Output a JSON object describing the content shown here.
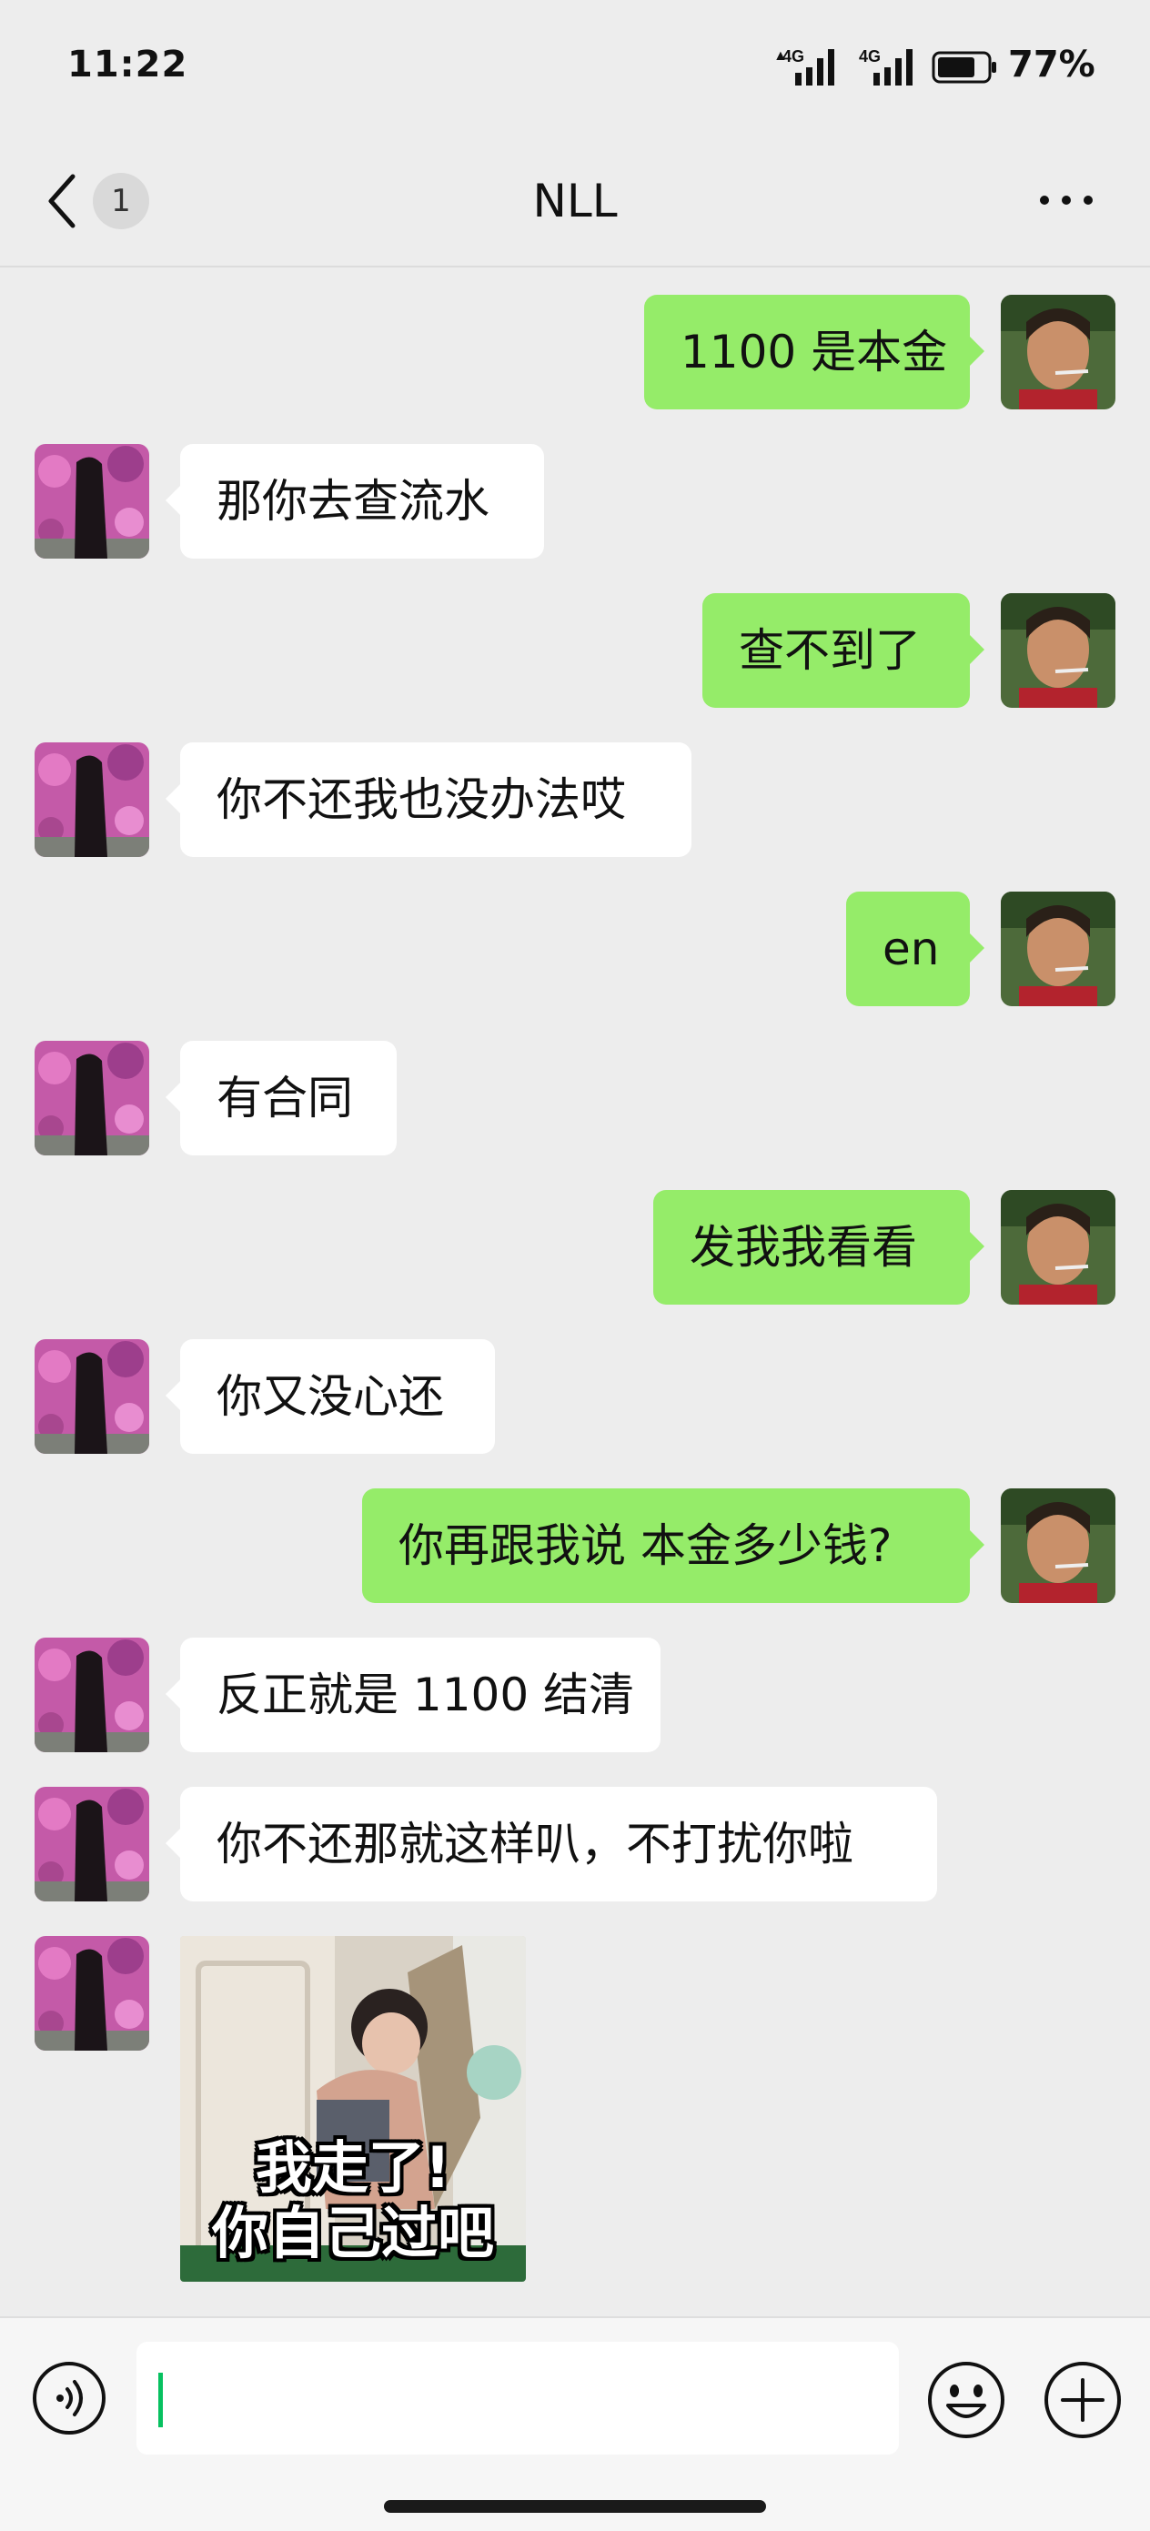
{
  "status_bar": {
    "time": "11:22",
    "network1": "4G",
    "network2": "4G",
    "battery": "77%"
  },
  "header": {
    "unread_count": "1",
    "title": "NLL"
  },
  "messages": [
    {
      "from": "me",
      "text": "1100 是本金"
    },
    {
      "from": "them",
      "text": "那你去查流水"
    },
    {
      "from": "me",
      "text": "查不到了"
    },
    {
      "from": "them",
      "text": "你不还我也没办法哎"
    },
    {
      "from": "me",
      "text": "en"
    },
    {
      "from": "them",
      "text": "有合同"
    },
    {
      "from": "me",
      "text": "发我我看看"
    },
    {
      "from": "them",
      "text": "你又没心还"
    },
    {
      "from": "me",
      "text": "你再跟我说  本金多少钱?"
    },
    {
      "from": "them",
      "text": "反正就是 1100 结清"
    },
    {
      "from": "them",
      "text": "你不还那就这样叭，不打扰你啦"
    }
  ],
  "sticker": {
    "line1": "我走了!",
    "line2": "你自己过吧"
  },
  "colors": {
    "background": "#ededed",
    "my_bubble": "#95ec69",
    "their_bubble": "#ffffff",
    "cursor": "#07c160"
  },
  "icons": [
    "back-icon",
    "more-icon",
    "voice-icon",
    "emoji-icon",
    "plus-icon"
  ]
}
